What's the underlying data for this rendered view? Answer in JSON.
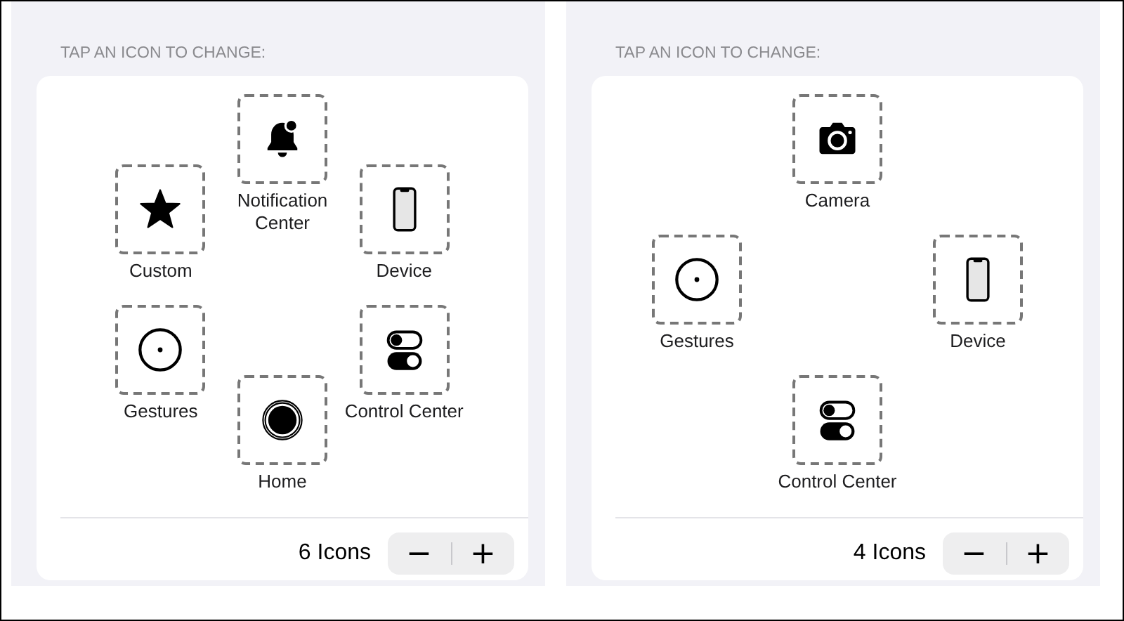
{
  "panels": [
    {
      "header": "TAP AN ICON TO CHANGE:",
      "icons": [
        {
          "kind": "bell",
          "label": "Notification Center"
        },
        {
          "kind": "phone",
          "label": "Device"
        },
        {
          "kind": "toggles",
          "label": "Control Center"
        },
        {
          "kind": "home",
          "label": "Home"
        },
        {
          "kind": "gestures",
          "label": "Gestures"
        },
        {
          "kind": "star",
          "label": "Custom"
        }
      ],
      "count": "6 Icons",
      "stepper": {
        "decrement": "−",
        "increment": "+"
      }
    },
    {
      "header": "TAP AN ICON TO CHANGE:",
      "icons": [
        {
          "kind": "camera",
          "label": "Camera"
        },
        {
          "kind": "phone",
          "label": "Device"
        },
        {
          "kind": "toggles",
          "label": "Control Center"
        },
        {
          "kind": "gestures",
          "label": "Gestures"
        }
      ],
      "count": "4 Icons",
      "stepper": {
        "decrement": "−",
        "increment": "+"
      }
    }
  ]
}
